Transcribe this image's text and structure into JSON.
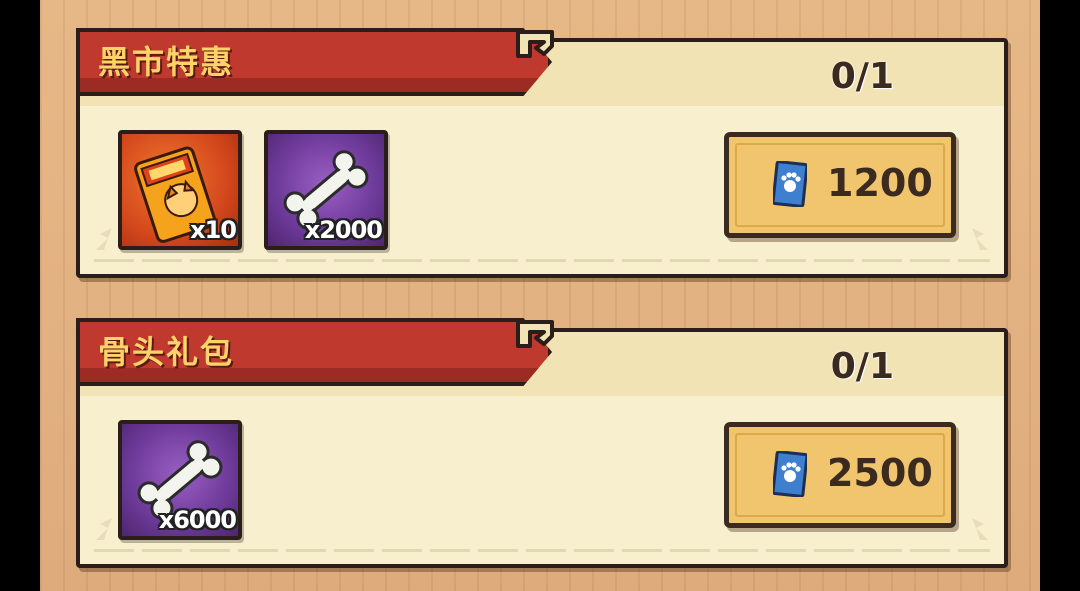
{
  "colors": {
    "wood": "#e3b282",
    "ribbon": "#c0392f",
    "ribbon_text": "#ffd36a",
    "panel": "#f7efce",
    "button": "#f0c56d",
    "outline": "#2b1e1a"
  },
  "packs": [
    {
      "title": "黑市特惠",
      "count": "0/1",
      "items": [
        {
          "icon": "food-bag-icon",
          "qty": "x10",
          "rarity": "orange"
        },
        {
          "icon": "bone-icon",
          "qty": "x2000",
          "rarity": "purple"
        }
      ],
      "price": "1200",
      "currency_icon": "paw-ticket-icon"
    },
    {
      "title": "骨头礼包",
      "count": "0/1",
      "items": [
        {
          "icon": "bone-icon",
          "qty": "x6000",
          "rarity": "purple"
        }
      ],
      "price": "2500",
      "currency_icon": "paw-ticket-icon"
    }
  ]
}
